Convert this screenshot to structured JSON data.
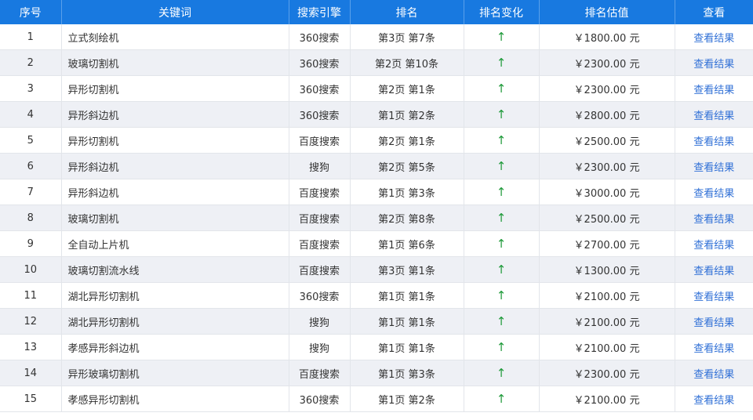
{
  "header": {
    "index": "序号",
    "keyword": "关键词",
    "engine": "搜索引擎",
    "rank": "排名",
    "change": "排名变化",
    "estimate": "排名估值",
    "view": "查看"
  },
  "change_icon": "up-arrow-icon",
  "colors": {
    "header_bg": "#1879e0",
    "up_arrow": "#1f9a3a",
    "link": "#2f6fd6",
    "stripe": "#eef0f5"
  },
  "rows": [
    {
      "index": "1",
      "keyword": "立式刻绘机",
      "engine": "360搜索",
      "rank": "第3页 第7条",
      "change": "↑",
      "estimate": "￥1800.00 元",
      "view": "查看结果"
    },
    {
      "index": "2",
      "keyword": "玻璃切割机",
      "engine": "360搜索",
      "rank": "第2页 第10条",
      "change": "↑",
      "estimate": "￥2300.00 元",
      "view": "查看结果"
    },
    {
      "index": "3",
      "keyword": "异形切割机",
      "engine": "360搜索",
      "rank": "第2页 第1条",
      "change": "↑",
      "estimate": "￥2300.00 元",
      "view": "查看结果"
    },
    {
      "index": "4",
      "keyword": "异形斜边机",
      "engine": "360搜索",
      "rank": "第1页 第2条",
      "change": "↑",
      "estimate": "￥2800.00 元",
      "view": "查看结果"
    },
    {
      "index": "5",
      "keyword": "异形切割机",
      "engine": "百度搜索",
      "rank": "第2页 第1条",
      "change": "↑",
      "estimate": "￥2500.00 元",
      "view": "查看结果"
    },
    {
      "index": "6",
      "keyword": "异形斜边机",
      "engine": "搜狗",
      "rank": "第2页 第5条",
      "change": "↑",
      "estimate": "￥2300.00 元",
      "view": "查看结果"
    },
    {
      "index": "7",
      "keyword": "异形斜边机",
      "engine": "百度搜索",
      "rank": "第1页 第3条",
      "change": "↑",
      "estimate": "￥3000.00 元",
      "view": "查看结果"
    },
    {
      "index": "8",
      "keyword": "玻璃切割机",
      "engine": "百度搜索",
      "rank": "第2页 第8条",
      "change": "↑",
      "estimate": "￥2500.00 元",
      "view": "查看结果"
    },
    {
      "index": "9",
      "keyword": "全自动上片机",
      "engine": "百度搜索",
      "rank": "第1页 第6条",
      "change": "↑",
      "estimate": "￥2700.00 元",
      "view": "查看结果"
    },
    {
      "index": "10",
      "keyword": "玻璃切割流水线",
      "engine": "百度搜索",
      "rank": "第3页 第1条",
      "change": "↑",
      "estimate": "￥1300.00 元",
      "view": "查看结果"
    },
    {
      "index": "11",
      "keyword": "湖北异形切割机",
      "engine": "360搜索",
      "rank": "第1页 第1条",
      "change": "↑",
      "estimate": "￥2100.00 元",
      "view": "查看结果"
    },
    {
      "index": "12",
      "keyword": "湖北异形切割机",
      "engine": "搜狗",
      "rank": "第1页 第1条",
      "change": "↑",
      "estimate": "￥2100.00 元",
      "view": "查看结果"
    },
    {
      "index": "13",
      "keyword": "孝感异形斜边机",
      "engine": "搜狗",
      "rank": "第1页 第1条",
      "change": "↑",
      "estimate": "￥2100.00 元",
      "view": "查看结果"
    },
    {
      "index": "14",
      "keyword": "异形玻璃切割机",
      "engine": "百度搜索",
      "rank": "第1页 第3条",
      "change": "↑",
      "estimate": "￥2300.00 元",
      "view": "查看结果"
    },
    {
      "index": "15",
      "keyword": "孝感异形切割机",
      "engine": "360搜索",
      "rank": "第1页 第2条",
      "change": "↑",
      "estimate": "￥2100.00 元",
      "view": "查看结果"
    }
  ]
}
